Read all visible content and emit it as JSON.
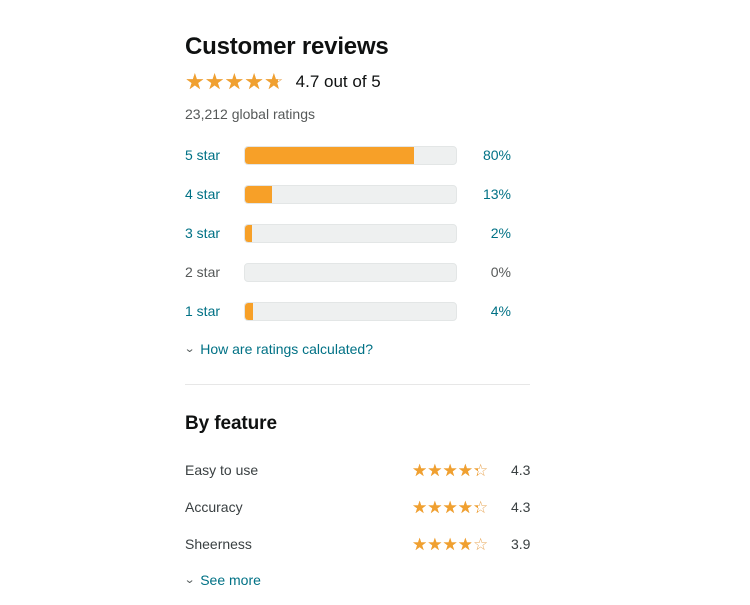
{
  "reviews": {
    "title": "Customer reviews",
    "overall_rating": 4.7,
    "overall_rating_text": "4.7 out of 5",
    "global_ratings_text": "23,212 global ratings",
    "histogram": [
      {
        "label": "5 star",
        "percent_text": "80%",
        "percent": 80,
        "interactive": true
      },
      {
        "label": "4 star",
        "percent_text": "13%",
        "percent": 13,
        "interactive": true
      },
      {
        "label": "3 star",
        "percent_text": "2%",
        "percent": 2,
        "interactive": true
      },
      {
        "label": "2 star",
        "percent_text": "0%",
        "percent": 0,
        "interactive": false
      },
      {
        "label": "1 star",
        "percent_text": "4%",
        "percent": 4,
        "interactive": true
      }
    ],
    "how_calculated_link": "How are ratings calculated?"
  },
  "by_feature": {
    "title": "By feature",
    "features": [
      {
        "name": "Easy to use",
        "score": 4.3,
        "score_text": "4.3"
      },
      {
        "name": "Accuracy",
        "score": 4.3,
        "score_text": "4.3"
      },
      {
        "name": "Sheerness",
        "score": 3.9,
        "score_text": "3.9"
      }
    ],
    "see_more_link": "See more"
  },
  "icons": {
    "chevron_down": "⌄",
    "star_filled": "★",
    "star_outline": "☆"
  },
  "colors": {
    "star": "#f0a030",
    "bar_fill": "#f7a028",
    "bar_track": "#eef0f0",
    "link": "#007185",
    "muted_text": "#565959",
    "heading": "#0f1111"
  }
}
